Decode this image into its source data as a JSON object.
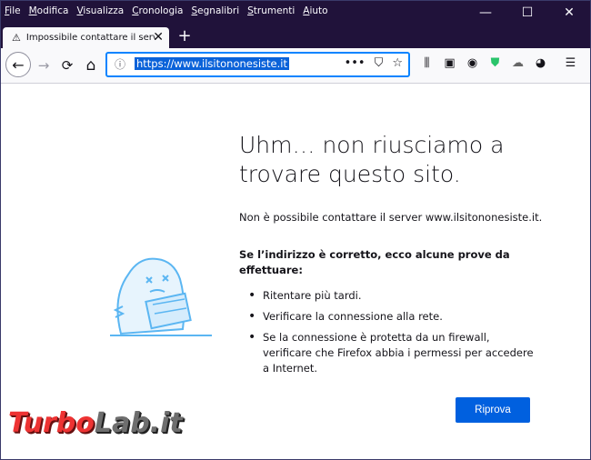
{
  "menu": [
    "File",
    "Modifica",
    "Visualizza",
    "Cronologia",
    "Segnalibri",
    "Strumenti",
    "Aiuto"
  ],
  "window_controls": {
    "minimize": "—",
    "maximize": "☐",
    "close": "✕"
  },
  "tab": {
    "title": "Impossibile contattare il server",
    "warning_icon": "warning-icon",
    "close": "✕"
  },
  "new_tab": "+",
  "nav": {
    "back": "←",
    "forward": "→",
    "reload": "⟳",
    "home": "⌂"
  },
  "url": {
    "info": "ⓘ",
    "value": "https://www.ilsitononesiste.it",
    "more": "•••",
    "pocket": "⛉",
    "bookmark": "☆"
  },
  "toolbar": {
    "library": "⫼",
    "sidebar": "▣",
    "account": "◉",
    "shield": "⛊",
    "ext1": "☁",
    "ext2": "◕",
    "menu": "☰"
  },
  "page": {
    "headline": "Uhm… non riusciamo a trovare questo sito.",
    "description": "Non è possibile contattare il server www.ilsitononesiste.it.",
    "subheading": "Se l’indirizzo è corretto, ecco alcune prove da effettuare:",
    "tips": [
      "Ritentare più tardi.",
      "Verificare la connessione alla rete.",
      "Se la connessione è protetta da un firewall, verificare che Firefox abbia i permessi per accedere a Internet."
    ],
    "retry_label": "Riprova"
  },
  "watermark": {
    "part1": "Turbo",
    "part2": "Lab.it"
  },
  "colors": {
    "titlebar": "#20123a",
    "accent": "#0060df",
    "url_focus": "#0a84ff"
  }
}
